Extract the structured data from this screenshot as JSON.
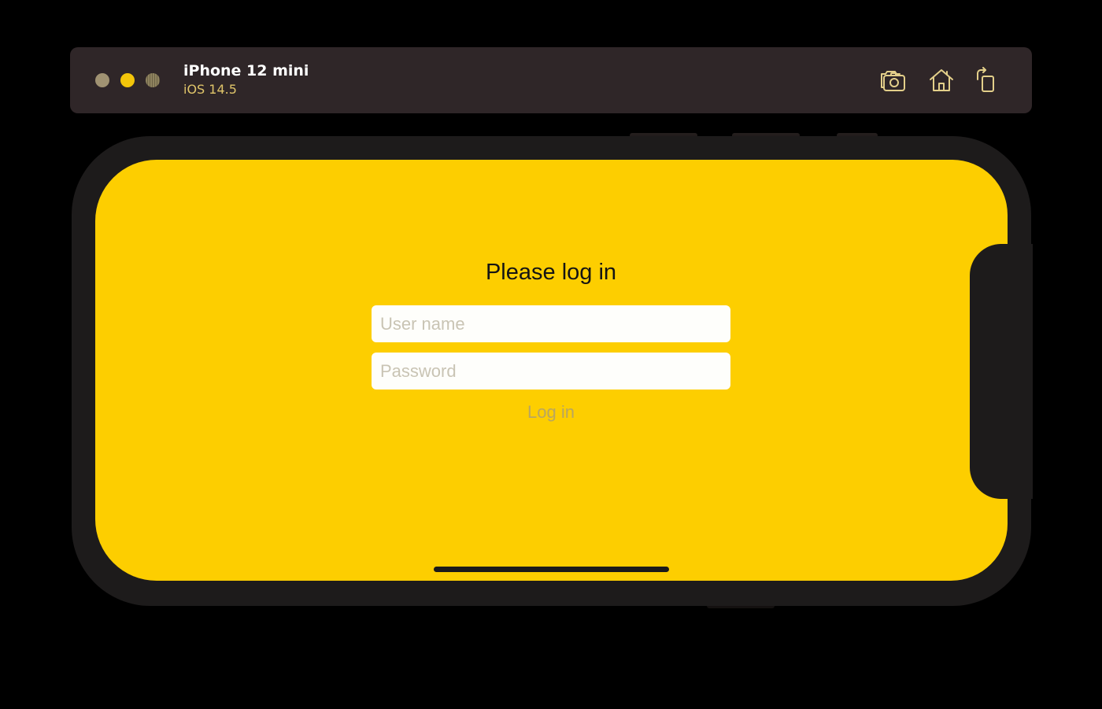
{
  "window": {
    "device_name": "iPhone 12 mini",
    "os_version": "iOS 14.5"
  },
  "toolbar": {
    "screenshot_icon": "camera-screenshot-icon",
    "home_icon": "home-icon",
    "rotate_icon": "rotate-icon"
  },
  "login": {
    "title": "Please log in",
    "username_placeholder": "User name",
    "username_value": "",
    "password_placeholder": "Password",
    "password_value": "",
    "button_label": "Log in"
  },
  "colors": {
    "screen_background": "#fdce00",
    "titlebar": "#2f2628",
    "accent_dot": "#f3c50a"
  }
}
